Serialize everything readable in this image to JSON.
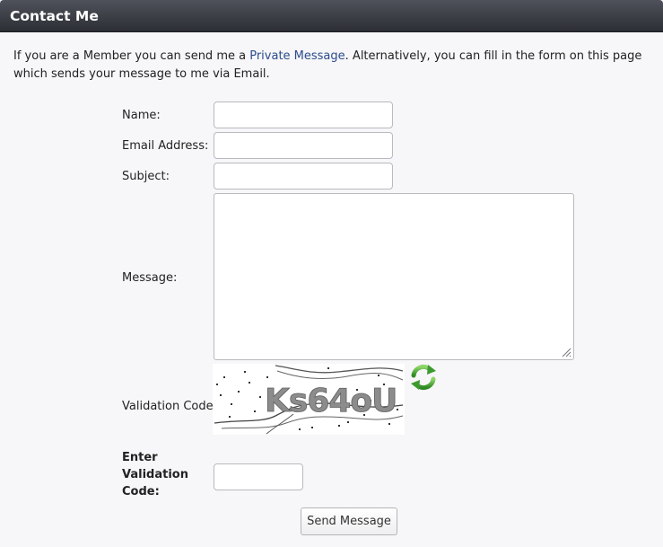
{
  "window": {
    "title": "Contact Me"
  },
  "intro": {
    "prefix": "If you are a Member you can send me a ",
    "link": "Private Message",
    "suffix": ". Alternatively, you can fill in the form on this page which sends your message to me via Email."
  },
  "form": {
    "name_label": "Name:",
    "name_value": "",
    "email_label": "Email Address:",
    "email_value": "",
    "subject_label": "Subject:",
    "subject_value": "",
    "message_label": "Message:",
    "message_value": "",
    "validation_label": "Validation Code:",
    "captcha_text": "Ks64oU",
    "enter_code_label": [
      "Enter",
      "Validation",
      "Code:"
    ],
    "enter_code_value": "",
    "submit_label": "Send Message"
  },
  "icons": {
    "refresh": "refresh-icon",
    "resize": "resize-grip-icon"
  },
  "colors": {
    "link": "#2a4c8d",
    "titlebar": "#3a3c42",
    "refresh_green": "#3c9a2e"
  }
}
